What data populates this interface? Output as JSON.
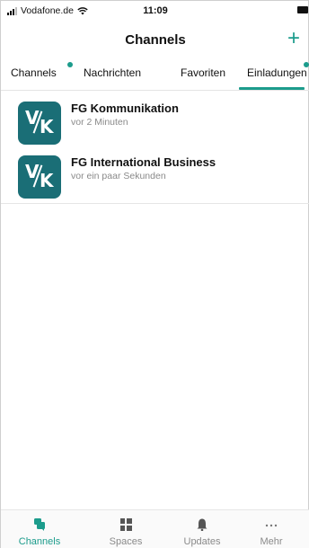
{
  "status": {
    "carrier": "Vodafone.de",
    "time": "11:09"
  },
  "nav": {
    "title": "Channels",
    "add_label": "+"
  },
  "tabs": [
    {
      "label": "Channels",
      "badge": true
    },
    {
      "label": "Nachrichten",
      "badge": false
    },
    {
      "label": "Favoriten",
      "badge": false
    },
    {
      "label": "Einladungen",
      "badge": true,
      "active": true
    }
  ],
  "invitations": [
    {
      "name": "FG Kommunikation",
      "time": "vor 2 Minuten",
      "logo": "V/K"
    },
    {
      "name": "FG International Business",
      "time": "vor ein paar Sekunden",
      "logo": "V/K"
    }
  ],
  "bottom_nav": [
    {
      "label": "Channels",
      "icon": "chat-bubbles-icon",
      "active": true
    },
    {
      "label": "Spaces",
      "icon": "grid-icon",
      "active": false
    },
    {
      "label": "Updates",
      "icon": "bell-icon",
      "active": false
    },
    {
      "label": "Mehr",
      "icon": "more-icon",
      "active": false
    }
  ],
  "colors": {
    "accent": "#1c9c8c",
    "logo_bg": "#1a6e76",
    "muted": "#8a8a8a"
  }
}
